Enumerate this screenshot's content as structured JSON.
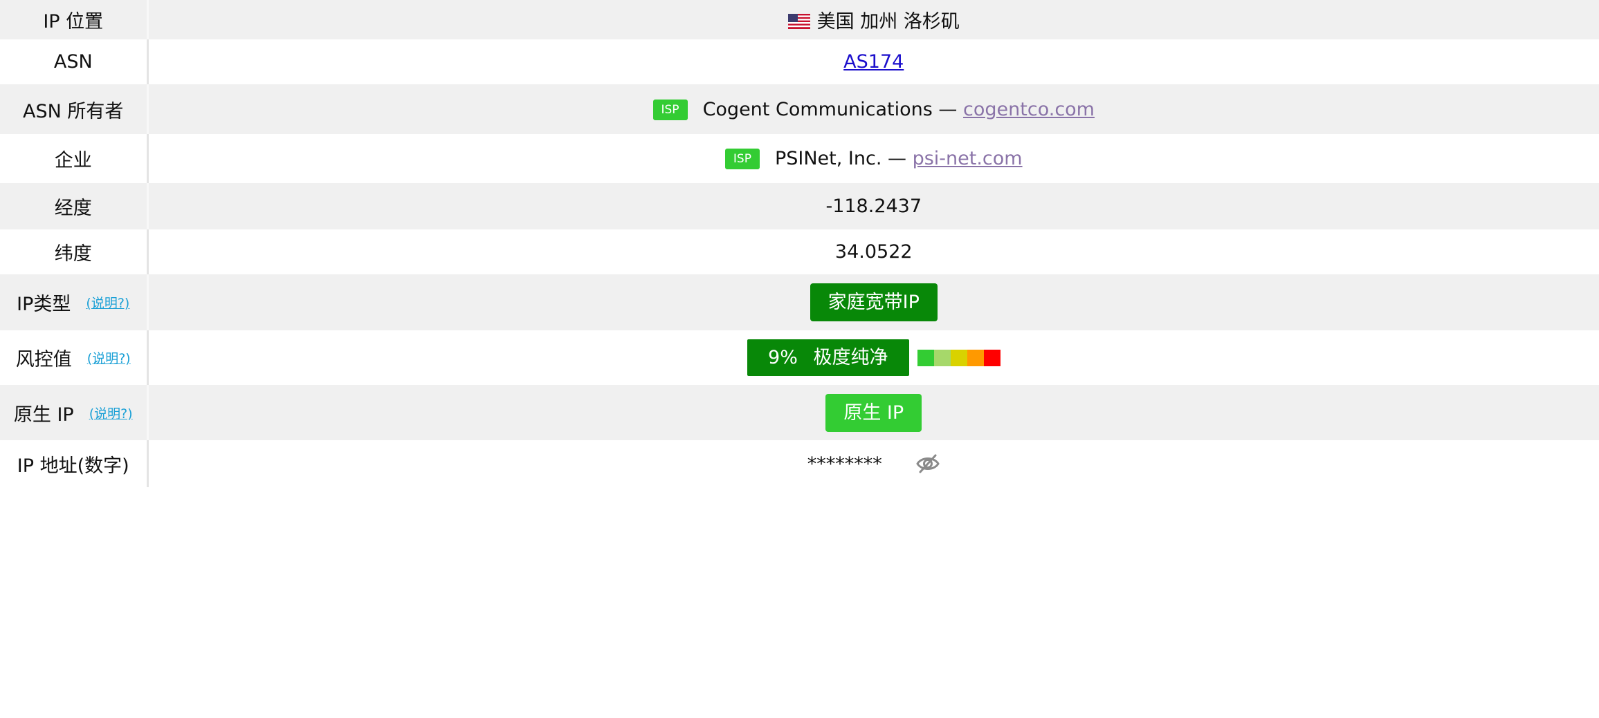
{
  "rows": {
    "location": {
      "label": "IP 位置",
      "value": "美国 加州 洛杉矶",
      "flag_icon": "us-flag-icon"
    },
    "asn": {
      "label": "ASN",
      "value": "AS174"
    },
    "asn_owner": {
      "label": "ASN 所有者",
      "badge": "ISP",
      "name": "Cogent Communications —",
      "domain": "cogentco.com"
    },
    "company": {
      "label": "企业",
      "badge": "ISP",
      "name": "PSINet, Inc. —",
      "domain": "psi-net.com"
    },
    "longitude": {
      "label": "经度",
      "value": "-118.2437"
    },
    "latitude": {
      "label": "纬度",
      "value": "34.0522"
    },
    "ip_type": {
      "label": "IP类型",
      "help": "(说明?)",
      "value": "家庭宽带IP"
    },
    "risk": {
      "label": "风控值",
      "help": "(说明?)",
      "value": "9%  极度纯净",
      "percent": 9
    },
    "native": {
      "label": "原生 IP",
      "help": "(说明?)",
      "value": "原生 IP"
    },
    "ip_numeric": {
      "label": "IP 地址(数字)",
      "value": "********",
      "toggle_icon": "eye-slash-icon"
    }
  },
  "colors": {
    "isp_badge": "#33cc33",
    "type_badge": "#088808",
    "risk_badge": "#088808",
    "native_badge": "#33cc33",
    "help_link": "#1aa0d6",
    "asn_link": "#1a0dcc",
    "domain_link": "#8a73a8",
    "risk_scale": [
      "#33cc33",
      "#a6d86a",
      "#d9d200",
      "#ff9900",
      "#ff0000"
    ]
  }
}
